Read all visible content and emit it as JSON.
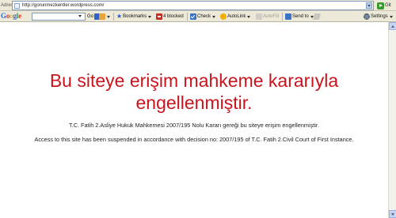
{
  "address_bar": {
    "label": "Adres",
    "url": "http://gorunmezkentler.wordpress.com/",
    "go_label": "Git"
  },
  "google_toolbar": {
    "logo_letters": [
      "G",
      "o",
      "o",
      "g",
      "l",
      "e"
    ],
    "go_label": "Go",
    "bookmarks_label": "Bookmarks",
    "blocked_label": "4 blocked",
    "check_label": "Check",
    "autolink_label": "AutoLink",
    "autofill_label": "AutoFill",
    "sendto_label": "Send to",
    "settings_label": "Settings"
  },
  "page": {
    "headline": "Bu siteye erişim mahkeme kararıyla engellenmiştir.",
    "notice_tr": "T.C. Fatih 2.Asliye Hukuk Mahkemesi 2007/195 Nolu Kararı gereği bu siteye erişim engellenmiştir.",
    "notice_en": "Access to this site has been suspended in accordance with decision no: 2007/195 of T.C. Fatih 2.Civil Court of First Instance.",
    "headline_color": "#c8141c"
  }
}
